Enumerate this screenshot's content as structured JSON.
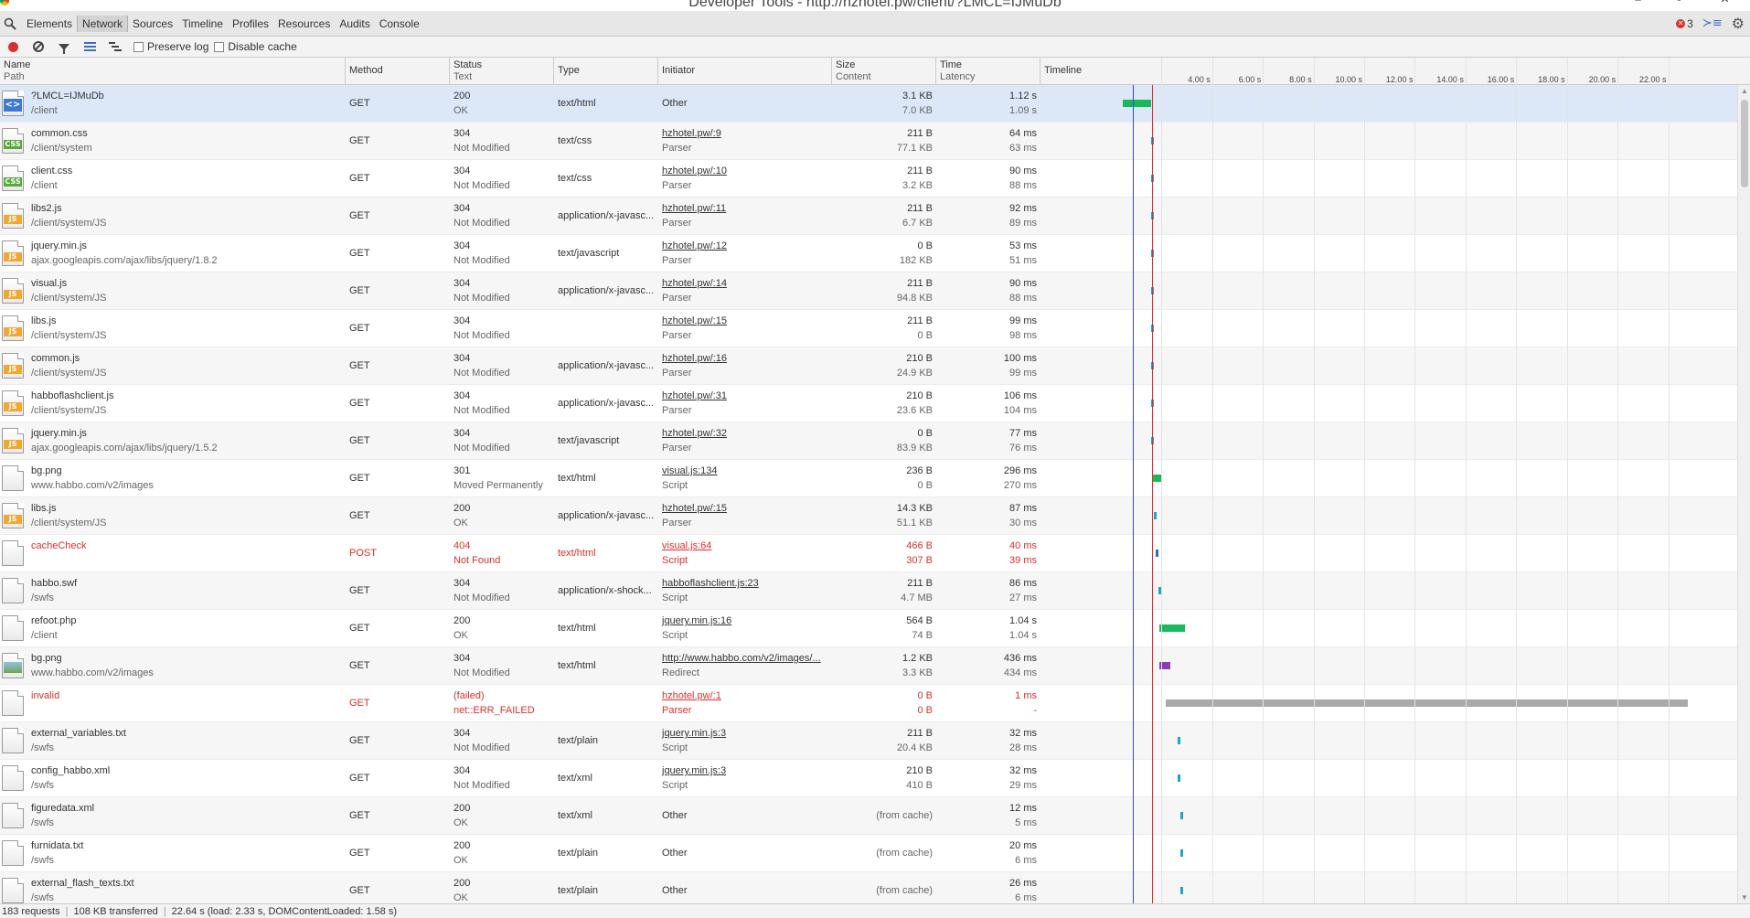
{
  "window": {
    "title": "Developer Tools - http://hzhotel.pw/client/?LMCL=IJMuDb"
  },
  "tabs": [
    "Elements",
    "Network",
    "Sources",
    "Timeline",
    "Profiles",
    "Resources",
    "Audits",
    "Console"
  ],
  "active_tab": "Network",
  "error_count": "3",
  "toolbar": {
    "preserve_log": "Preserve log",
    "disable_cache": "Disable cache"
  },
  "columns": {
    "name": "Name",
    "path": "Path",
    "method": "Method",
    "status": "Status",
    "text": "Text",
    "type": "Type",
    "initiator": "Initiator",
    "size": "Size",
    "content": "Content",
    "time": "Time",
    "latency": "Latency",
    "timeline": "Timeline"
  },
  "timeline_ticks": [
    "4.00 s",
    "6.00 s",
    "8.00 s",
    "10.00 s",
    "12.00 s",
    "14.00 s",
    "16.00 s",
    "18.00 s",
    "20.00 s",
    "22.00 s"
  ],
  "rows": [
    {
      "name": "?LMCL=IJMuDb",
      "path": "/client",
      "method": "GET",
      "status": "200",
      "text": "OK",
      "type": "text/html",
      "initiator": "Other",
      "initiator_sub": "",
      "size": "3.1 KB",
      "content": "7.0 KB",
      "time": "1.12 s",
      "latency": "1.09 s",
      "icon": "html",
      "state": "selected"
    },
    {
      "name": "common.css",
      "path": "/client/system",
      "method": "GET",
      "status": "304",
      "text": "Not Modified",
      "type": "text/css",
      "initiator": "hzhotel.pw/:9",
      "initiator_sub": "Parser",
      "size": "211 B",
      "content": "77.1 KB",
      "time": "64 ms",
      "latency": "63 ms",
      "icon": "css",
      "state": ""
    },
    {
      "name": "client.css",
      "path": "/client",
      "method": "GET",
      "status": "304",
      "text": "Not Modified",
      "type": "text/css",
      "initiator": "hzhotel.pw/:10",
      "initiator_sub": "Parser",
      "size": "211 B",
      "content": "3.2 KB",
      "time": "90 ms",
      "latency": "88 ms",
      "icon": "css",
      "state": ""
    },
    {
      "name": "libs2.js",
      "path": "/client/system/JS",
      "method": "GET",
      "status": "304",
      "text": "Not Modified",
      "type": "application/x-javasc...",
      "initiator": "hzhotel.pw/:11",
      "initiator_sub": "Parser",
      "size": "211 B",
      "content": "6.7 KB",
      "time": "92 ms",
      "latency": "89 ms",
      "icon": "js",
      "state": ""
    },
    {
      "name": "jquery.min.js",
      "path": "ajax.googleapis.com/ajax/libs/jquery/1.8.2",
      "method": "GET",
      "status": "304",
      "text": "Not Modified",
      "type": "text/javascript",
      "initiator": "hzhotel.pw/:12",
      "initiator_sub": "Parser",
      "size": "0 B",
      "content": "182 KB",
      "time": "53 ms",
      "latency": "51 ms",
      "icon": "js",
      "state": ""
    },
    {
      "name": "visual.js",
      "path": "/client/system/JS",
      "method": "GET",
      "status": "304",
      "text": "Not Modified",
      "type": "application/x-javasc...",
      "initiator": "hzhotel.pw/:14",
      "initiator_sub": "Parser",
      "size": "211 B",
      "content": "94.8 KB",
      "time": "90 ms",
      "latency": "88 ms",
      "icon": "js",
      "state": ""
    },
    {
      "name": "libs.js",
      "path": "/client/system/JS",
      "method": "GET",
      "status": "304",
      "text": "Not Modified",
      "type": "",
      "initiator": "hzhotel.pw/:15",
      "initiator_sub": "Parser",
      "size": "211 B",
      "content": "0 B",
      "time": "99 ms",
      "latency": "98 ms",
      "icon": "js",
      "state": ""
    },
    {
      "name": "common.js",
      "path": "/client/system/JS",
      "method": "GET",
      "status": "304",
      "text": "Not Modified",
      "type": "application/x-javasc...",
      "initiator": "hzhotel.pw/:16",
      "initiator_sub": "Parser",
      "size": "210 B",
      "content": "24.9 KB",
      "time": "100 ms",
      "latency": "99 ms",
      "icon": "js",
      "state": ""
    },
    {
      "name": "habboflashclient.js",
      "path": "/client/system/JS",
      "method": "GET",
      "status": "304",
      "text": "Not Modified",
      "type": "application/x-javasc...",
      "initiator": "hzhotel.pw/:31",
      "initiator_sub": "Parser",
      "size": "210 B",
      "content": "23.6 KB",
      "time": "106 ms",
      "latency": "104 ms",
      "icon": "js",
      "state": ""
    },
    {
      "name": "jquery.min.js",
      "path": "ajax.googleapis.com/ajax/libs/jquery/1.5.2",
      "method": "GET",
      "status": "304",
      "text": "Not Modified",
      "type": "text/javascript",
      "initiator": "hzhotel.pw/:32",
      "initiator_sub": "Parser",
      "size": "0 B",
      "content": "83.9 KB",
      "time": "77 ms",
      "latency": "76 ms",
      "icon": "js",
      "state": ""
    },
    {
      "name": "bg.png",
      "path": "www.habbo.com/v2/images",
      "method": "GET",
      "status": "301",
      "text": "Moved Permanently",
      "type": "text/html",
      "initiator": "visual.js:134",
      "initiator_sub": "Script",
      "size": "236 B",
      "content": "0 B",
      "time": "296 ms",
      "latency": "270 ms",
      "icon": "blank",
      "state": ""
    },
    {
      "name": "libs.js",
      "path": "/client/system/JS",
      "method": "GET",
      "status": "200",
      "text": "OK",
      "type": "application/x-javasc...",
      "initiator": "hzhotel.pw/:15",
      "initiator_sub": "Parser",
      "size": "14.3 KB",
      "content": "51.1 KB",
      "time": "87 ms",
      "latency": "30 ms",
      "icon": "js",
      "state": ""
    },
    {
      "name": "cacheCheck",
      "path": "",
      "method": "POST",
      "status": "404",
      "text": "Not Found",
      "type": "text/html",
      "initiator": "visual.js:64",
      "initiator_sub": "Script",
      "size": "466 B",
      "content": "307 B",
      "time": "40 ms",
      "latency": "39 ms",
      "icon": "blank",
      "state": "error"
    },
    {
      "name": "habbo.swf",
      "path": "/swfs",
      "method": "GET",
      "status": "304",
      "text": "Not Modified",
      "type": "application/x-shock...",
      "initiator": "habboflashclient.js:23",
      "initiator_sub": "Script",
      "size": "211 B",
      "content": "4.7 MB",
      "time": "86 ms",
      "latency": "27 ms",
      "icon": "blank",
      "state": ""
    },
    {
      "name": "refoot.php",
      "path": "/client",
      "method": "GET",
      "status": "200",
      "text": "OK",
      "type": "text/html",
      "initiator": "jquery.min.js:16",
      "initiator_sub": "Script",
      "size": "564 B",
      "content": "74 B",
      "time": "1.04 s",
      "latency": "1.04 s",
      "icon": "blank",
      "state": ""
    },
    {
      "name": "bg.png",
      "path": "www.habbo.com/v2/images",
      "method": "GET",
      "status": "304",
      "text": "Not Modified",
      "type": "text/html",
      "initiator": "http://www.habbo.com/v2/images/...",
      "initiator_sub": "Redirect",
      "size": "1.2 KB",
      "content": "3.3 KB",
      "time": "436 ms",
      "latency": "434 ms",
      "icon": "img",
      "state": ""
    },
    {
      "name": "invalid",
      "path": "",
      "method": "GET",
      "status": "(failed)",
      "text": "net::ERR_FAILED",
      "type": "",
      "initiator": "hzhotel.pw/:1",
      "initiator_sub": "Parser",
      "size": "0 B",
      "content": "0 B",
      "time": "1 ms",
      "latency": "-",
      "icon": "blank",
      "state": "error"
    },
    {
      "name": "external_variables.txt",
      "path": "/swfs",
      "method": "GET",
      "status": "304",
      "text": "Not Modified",
      "type": "text/plain",
      "initiator": "jquery.min.js:3",
      "initiator_sub": "Script",
      "size": "211 B",
      "content": "20.4 KB",
      "time": "32 ms",
      "latency": "28 ms",
      "icon": "blank",
      "state": ""
    },
    {
      "name": "config_habbo.xml",
      "path": "/swfs",
      "method": "GET",
      "status": "304",
      "text": "Not Modified",
      "type": "text/xml",
      "initiator": "jquery.min.js:3",
      "initiator_sub": "Script",
      "size": "210 B",
      "content": "410 B",
      "time": "32 ms",
      "latency": "29 ms",
      "icon": "blank",
      "state": ""
    },
    {
      "name": "figuredata.xml",
      "path": "/swfs",
      "method": "GET",
      "status": "200",
      "text": "OK",
      "type": "text/xml",
      "initiator": "Other",
      "initiator_sub": "",
      "size": "(from cache)",
      "content": "",
      "time": "12 ms",
      "latency": "5 ms",
      "icon": "blank",
      "state": ""
    },
    {
      "name": "furnidata.txt",
      "path": "/swfs",
      "method": "GET",
      "status": "200",
      "text": "OK",
      "type": "text/plain",
      "initiator": "Other",
      "initiator_sub": "",
      "size": "(from cache)",
      "content": "",
      "time": "20 ms",
      "latency": "6 ms",
      "icon": "blank",
      "state": ""
    },
    {
      "name": "external_flash_texts.txt",
      "path": "/swfs",
      "method": "GET",
      "status": "200",
      "text": "OK",
      "type": "text/plain",
      "initiator": "Other",
      "initiator_sub": "",
      "size": "(from cache)",
      "content": "",
      "time": "26 ms",
      "latency": "6 ms",
      "icon": "blank",
      "state": ""
    }
  ],
  "timeline_bars": [
    {
      "start_s": 1.2,
      "dur_s": 1.12,
      "color": "#17b95a"
    },
    {
      "start_s": 2.3,
      "dur_s": 0.08,
      "color": "#1aa6c8"
    },
    {
      "start_s": 2.3,
      "dur_s": 0.09,
      "color": "#1aa6c8"
    },
    {
      "start_s": 2.3,
      "dur_s": 0.09,
      "color": "#1aa6c8"
    },
    {
      "start_s": 2.3,
      "dur_s": 0.06,
      "color": "#1aa6c8"
    },
    {
      "start_s": 2.3,
      "dur_s": 0.09,
      "color": "#1aa6c8"
    },
    {
      "start_s": 2.3,
      "dur_s": 0.1,
      "color": "#1aa6c8"
    },
    {
      "start_s": 2.3,
      "dur_s": 0.1,
      "color": "#1aa6c8"
    },
    {
      "start_s": 2.3,
      "dur_s": 0.11,
      "color": "#1aa6c8"
    },
    {
      "start_s": 2.3,
      "dur_s": 0.08,
      "color": "#1aa6c8"
    },
    {
      "start_s": 2.4,
      "dur_s": 0.3,
      "color": "#17b95a"
    },
    {
      "start_s": 2.42,
      "dur_s": 0.09,
      "color": "#1aa6c8"
    },
    {
      "start_s": 2.5,
      "dur_s": 0.05,
      "color": "#2a6fb8"
    },
    {
      "start_s": 2.6,
      "dur_s": 0.09,
      "color": "#1aa6c8"
    },
    {
      "start_s": 2.62,
      "dur_s": 1.04,
      "color": "#17b95a"
    },
    {
      "start_s": 2.62,
      "dur_s": 0.44,
      "color": "#8a3bb8"
    },
    {
      "start_s": 2.9,
      "dur_s": 20.6,
      "color": "#a9a9a9"
    },
    {
      "start_s": 3.37,
      "dur_s": 0.06,
      "color": "#1aa6c8"
    },
    {
      "start_s": 3.37,
      "dur_s": 0.06,
      "color": "#1aa6c8"
    },
    {
      "start_s": 3.48,
      "dur_s": 0.05,
      "color": "#1aa6c8"
    },
    {
      "start_s": 3.48,
      "dur_s": 0.05,
      "color": "#1aa6c8"
    },
    {
      "start_s": 3.48,
      "dur_s": 0.05,
      "color": "#1aa6c8"
    }
  ],
  "timeline_markers": {
    "scale_max_s": 24.4,
    "domcontentloaded_s": 1.58,
    "load_s": 2.33,
    "domcontentloaded_color": "#3b46d6",
    "load_color": "#e0302c"
  },
  "status": {
    "requests": "183 requests",
    "transferred": "108 KB transferred",
    "timing": "22.64 s (load: 2.33 s, DOMContentLoaded: 1.58 s)"
  }
}
